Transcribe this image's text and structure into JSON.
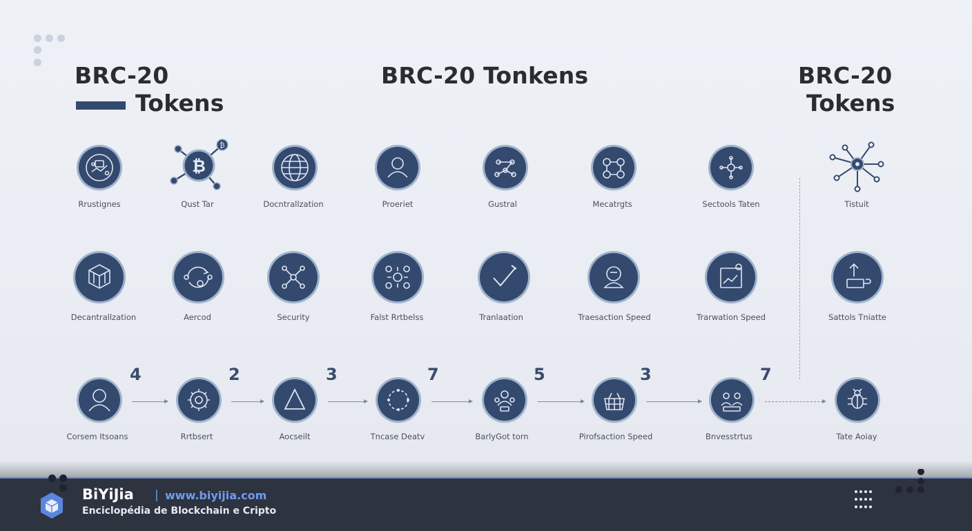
{
  "titles": {
    "left_line1": "BRC-20",
    "left_line2": "Tokens",
    "center": "BRC-20 Tonkens",
    "right_line1": "BRC-20",
    "right_line2": "Tokens"
  },
  "row1": [
    {
      "label": "Rrustignes",
      "icon": "hand-data-icon"
    },
    {
      "label": "Qust Tar",
      "icon": "bitcoin-network-icon"
    },
    {
      "label": "Docntrallzation",
      "icon": "globe-icon"
    },
    {
      "label": "Proeriet",
      "icon": "user-icon"
    },
    {
      "label": "Gustral",
      "icon": "network-nodes-icon"
    },
    {
      "label": "Mecatrgts",
      "icon": "linked-nodes-icon"
    },
    {
      "label": "Sectools Taten",
      "icon": "cross-nodes-icon"
    },
    {
      "label": "Tistuit",
      "icon": "hub-network-icon"
    }
  ],
  "row2": [
    {
      "label": "Decantrallzation",
      "icon": "cube-shield-icon"
    },
    {
      "label": "Aercod",
      "icon": "cycle-icon"
    },
    {
      "label": "Security",
      "icon": "network-icon"
    },
    {
      "label": "Falst Rrtbelss",
      "icon": "gear-cluster-icon"
    },
    {
      "label": "Tranlaation",
      "icon": "checkmark-icon"
    },
    {
      "label": "Traesaction Speed",
      "icon": "profile-icon"
    },
    {
      "label": "Trarwation Speed",
      "icon": "document-chart-icon"
    },
    {
      "label": "Sattols Tniatte",
      "icon": "upload-icon"
    }
  ],
  "row3": [
    {
      "label": "Corsem Itsoans",
      "icon": "person-icon",
      "number": "4"
    },
    {
      "label": "Rrtbsert",
      "icon": "gear-icon",
      "number": "2"
    },
    {
      "label": "Aocseilt",
      "icon": "triangle-icon",
      "number": "3"
    },
    {
      "label": "Tncase Deatv",
      "icon": "cycle-icon",
      "number": "7"
    },
    {
      "label": "BarlyGot torn",
      "icon": "people-icon",
      "number": "5"
    },
    {
      "label": "Pirofsaction Speed",
      "icon": "basket-icon",
      "number": "3"
    },
    {
      "label": "Bnvesstrtus",
      "icon": "team-icon",
      "number": "7"
    },
    {
      "label": "Tate Aoiay",
      "icon": "bug-icon"
    }
  ],
  "footer": {
    "brand": "BiYiJia",
    "separator": "|",
    "url": "www.biyijia.com",
    "tagline": "Enciclopédia de Blockchain e Cripto"
  },
  "colors": {
    "circle_fill": "#34496e",
    "circle_ring": "#9fb2cc",
    "footer_bg": "#2e3340",
    "url_blue": "#6d9cf0"
  }
}
